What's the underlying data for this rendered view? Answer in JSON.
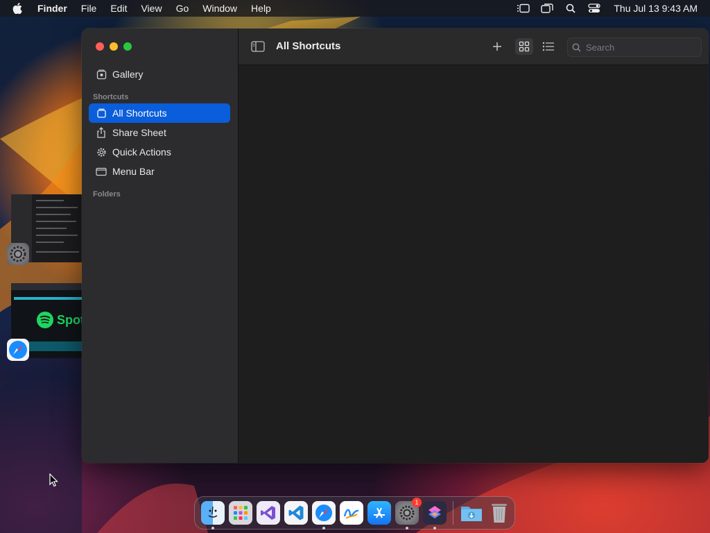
{
  "menubar": {
    "app_name": "Finder",
    "items": [
      "File",
      "Edit",
      "View",
      "Go",
      "Window",
      "Help"
    ],
    "clock": "Thu Jul 13  9:43 AM",
    "status_icons": [
      "stage-manager-icon",
      "screen-mirroring-icon",
      "spotlight-icon",
      "control-center-icon"
    ]
  },
  "window": {
    "title": "All Shortcuts",
    "search_placeholder": "Search",
    "sidebar": {
      "gallery_label": "Gallery",
      "shortcuts_header": "Shortcuts",
      "items": [
        {
          "label": "All Shortcuts",
          "icon": "shortcuts-stack-icon",
          "selected": true
        },
        {
          "label": "Share Sheet",
          "icon": "share-icon",
          "selected": false
        },
        {
          "label": "Quick Actions",
          "icon": "gear-icon",
          "selected": false
        },
        {
          "label": "Menu Bar",
          "icon": "menubar-icon",
          "selected": false
        }
      ],
      "folders_header": "Folders"
    },
    "toolbar_icons": [
      "sidebar-toggle-icon",
      "plus-icon",
      "grid-view-icon",
      "list-view-icon"
    ]
  },
  "thumbnails": {
    "spotify_text": "Spot"
  },
  "dock": {
    "apps": [
      {
        "name": "finder",
        "running": true
      },
      {
        "name": "launchpad",
        "running": false
      },
      {
        "name": "visual-studio",
        "running": false
      },
      {
        "name": "vscode",
        "running": false
      },
      {
        "name": "safari",
        "running": true
      },
      {
        "name": "freeform",
        "running": false
      },
      {
        "name": "app-store",
        "running": false
      },
      {
        "name": "system-settings",
        "running": true,
        "badge": "1"
      },
      {
        "name": "shortcuts",
        "running": true
      }
    ],
    "extras": [
      "downloads-folder",
      "trash"
    ]
  },
  "colors": {
    "accent": "#0a5ddb",
    "sidebar_bg": "#2c2c2e",
    "content_bg": "#1e1e1e"
  }
}
